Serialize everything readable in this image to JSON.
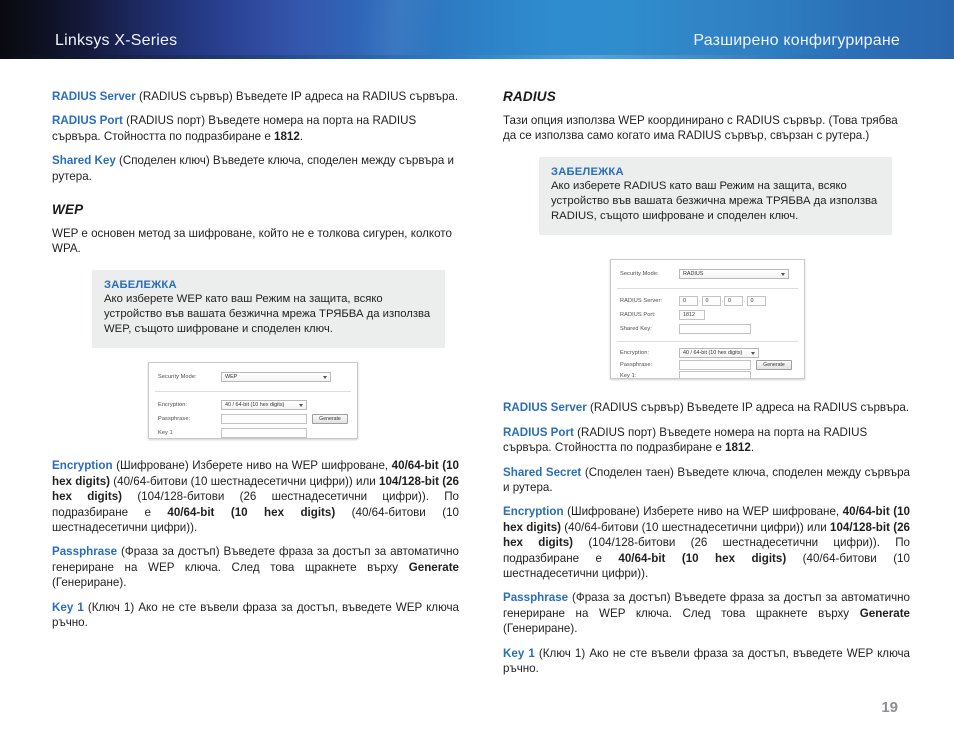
{
  "header": {
    "left_title": "Linksys X-Series",
    "right_title": "Разширено конфигуриране"
  },
  "left_column": {
    "paragraphs": [
      {
        "term": "RADIUS Server",
        "text": " (RADIUS сървър)  Въведете IP адреса на RADIUS сървъра."
      },
      {
        "term": "RADIUS Port",
        "text": " (RADIUS порт)  Въведете номера на порта на RADIUS сървъра. Стойността по подразбиране е ",
        "bold": "1812",
        "tail": "."
      },
      {
        "term": "Shared Key",
        "text": " (Споделен ключ)  Въведете ключа, споделен между сървъра и рутера."
      }
    ],
    "section_heading": "WEP",
    "section_intro": "WEP е основен метод за шифроване, който не е толкова сигурен, колкото WPA.",
    "note": {
      "title": "ЗАБЕЛЕЖКА",
      "body": "Ако изберете WEP като ваш Режим на защита, всяко устройство във вашата безжична мрежа ТРЯБВА да използва WEP, същото шифроване и споделен ключ."
    },
    "screenshot": {
      "security_mode_label": "Security Mode:",
      "security_mode_value": "WEP",
      "encryption_label": "Encryption:",
      "encryption_value": "40 / 64-bit (10 hex digits)",
      "passphrase_label": "Passphrase:",
      "passphrase_value": "",
      "generate_button": "Generate",
      "key1_label": "Key 1",
      "key1_value": ""
    },
    "detail_paragraphs": [
      {
        "term": "Encryption",
        "parts": [
          {
            "t": " (Шифроване) Изберете ниво на WEP шифроване, ",
            "b": false
          },
          {
            "t": "40/64-bit (10 hex digits)",
            "b": true
          },
          {
            "t": " (40/64-битови (10 шестнадесетични цифри)) или ",
            "b": false
          },
          {
            "t": "104/128-bit (26 hex digits)",
            "b": true
          },
          {
            "t": " (104/128-битови (26 шестнадесетични цифри)). По подразбиране е ",
            "b": false
          },
          {
            "t": "40/64-bit (10 hex digits)",
            "b": true
          },
          {
            "t": " (40/64-битови (10 шестнадесетични цифри)).",
            "b": false
          }
        ]
      },
      {
        "term": "Passphrase",
        "parts": [
          {
            "t": " (Фраза за достъп) Въведете фраза за достъп за автоматично генериране на WEP ключа. След това щракнете върху ",
            "b": false
          },
          {
            "t": "Generate",
            "b": true
          },
          {
            "t": " (Генериране).",
            "b": false
          }
        ]
      },
      {
        "term": "Key 1",
        "parts": [
          {
            "t": " (Ключ 1)  Ако не сте въвели фраза за достъп, въведете WEP ключа ръчно.",
            "b": false
          }
        ]
      }
    ]
  },
  "right_column": {
    "section_heading": "RADIUS",
    "section_intro": "Тази опция използва WEP координирано с RADIUS сървър. (Това трябва да се използва само когато има RADIUS сървър, свързан с рутера.)",
    "note": {
      "title": "ЗАБЕЛЕЖКА",
      "body": "Ако изберете RADIUS като ваш Режим на защита, всяко устройство във вашата безжична мрежа ТРЯБВА да използва RADIUS, същото шифроване и споделен ключ."
    },
    "screenshot": {
      "security_mode_label": "Security Mode:",
      "security_mode_value": "RADIUS",
      "radius_server_label": "RADIUS Server:",
      "radius_server_octets": [
        "0",
        "0",
        "0",
        "0"
      ],
      "radius_port_label": "RADIUS Port:",
      "radius_port_value": "1812",
      "shared_key_label": "Shared Key:",
      "shared_key_value": "",
      "encryption_label": "Encryption:",
      "encryption_value": "40 / 64-bit (10 hex digits)",
      "passphrase_label": "Passphrase:",
      "passphrase_value": "",
      "generate_button": "Generate",
      "key1_label": "Key 1:",
      "key1_value": ""
    },
    "detail_paragraphs": [
      {
        "term": "RADIUS Server",
        "parts": [
          {
            "t": " (RADIUS сървър)  Въведете IP адреса на RADIUS сървъра.",
            "b": false
          }
        ]
      },
      {
        "term": "RADIUS Port",
        "parts": [
          {
            "t": " (RADIUS порт)  Въведете номера на порта на RADIUS сървъра. Стойността по подразбиране е ",
            "b": false
          },
          {
            "t": "1812",
            "b": true
          },
          {
            "t": ".",
            "b": false
          }
        ]
      },
      {
        "term": "Shared Secret",
        "parts": [
          {
            "t": " (Споделен таен)  Въведете ключа, споделен между сървъра и рутера.",
            "b": false
          }
        ]
      },
      {
        "term": "Encryption",
        "parts": [
          {
            "t": " (Шифроване) Изберете ниво на WEP шифроване, ",
            "b": false
          },
          {
            "t": "40/64-bit (10 hex digits)",
            "b": true
          },
          {
            "t": " (40/64-битови (10 шестнадесетични цифри)) или ",
            "b": false
          },
          {
            "t": "104/128-bit (26 hex digits)",
            "b": true
          },
          {
            "t": " (104/128-битови (26 шестнадесетични цифри)). По подразбиране е ",
            "b": false
          },
          {
            "t": "40/64-bit (10 hex digits)",
            "b": true
          },
          {
            "t": " (40/64-битови (10 шестнадесетични цифри)).",
            "b": false
          }
        ]
      },
      {
        "term": "Passphrase",
        "parts": [
          {
            "t": " (Фраза за достъп) Въведете фраза за достъп за автоматично генериране на WEP ключа. След това щракнете върху ",
            "b": false
          },
          {
            "t": "Generate",
            "b": true
          },
          {
            "t": " (Генериране).",
            "b": false
          }
        ]
      },
      {
        "term": "Key 1",
        "parts": [
          {
            "t": " (Ключ 1)  Ако не сте въвели фраза за достъп, въведете WEP ключа ръчно.",
            "b": false
          }
        ]
      }
    ]
  },
  "footer": {
    "page_number": "19"
  },
  "colors": {
    "term_blue": "#2a6ebb",
    "note_bg": "#eceded",
    "header_dark": "#0a0b12",
    "header_blue": "#2f8cce",
    "page_number": "#8d8f93"
  }
}
